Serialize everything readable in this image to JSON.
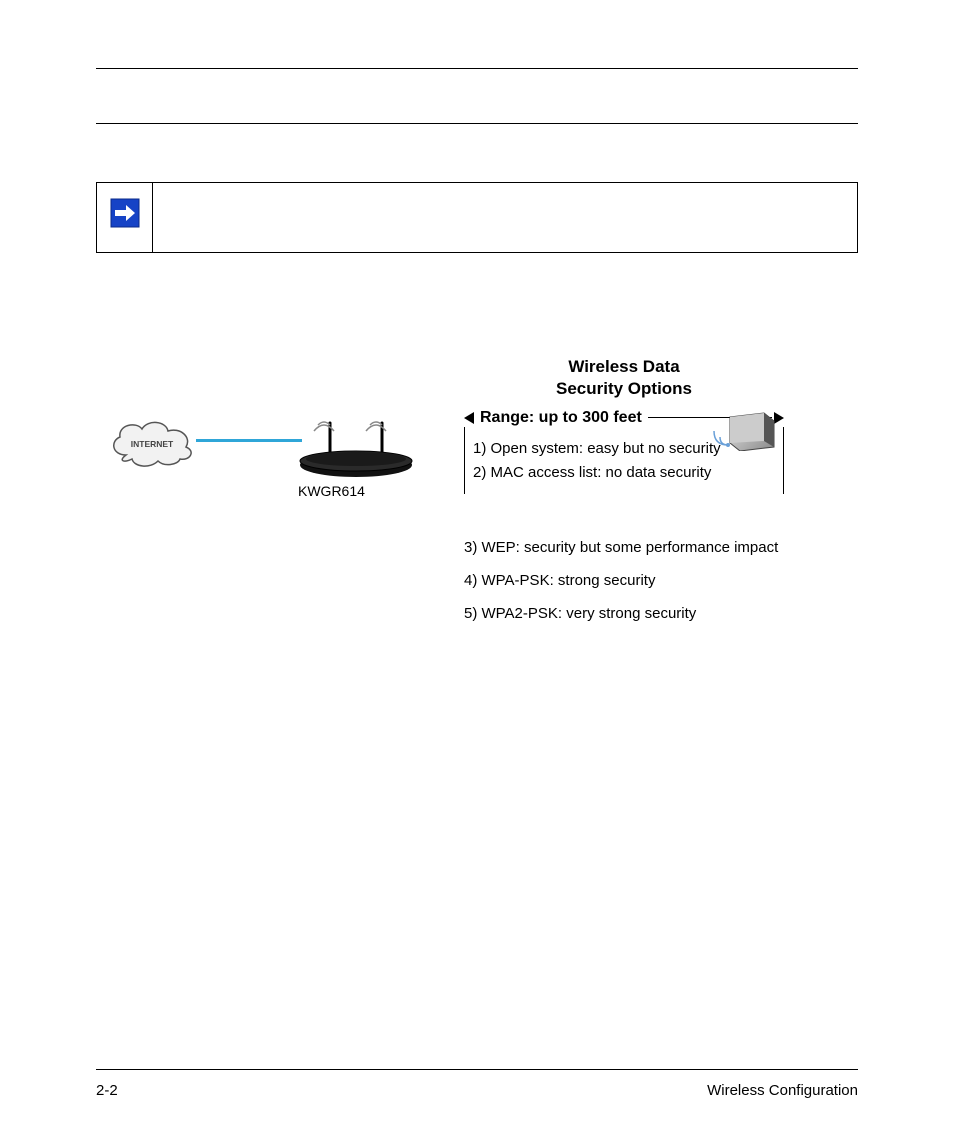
{
  "note": {
    "text": ""
  },
  "figure": {
    "router_label": "KWGR614",
    "title_line1": "Wireless Data",
    "title_line2": "Security Options",
    "range_label": "Range: up to 300 feet",
    "options": {
      "o1": "1) Open system: easy but no security",
      "o2": "2) MAC access list: no data security",
      "o3": "3) WEP: security but some performance impact",
      "o4": "4) WPA-PSK: strong security",
      "o5": "5) WPA2-PSK: very strong security"
    },
    "internet_label": "INTERNET"
  },
  "footer": {
    "page_number": "2-2",
    "section_title": "Wireless Configuration"
  }
}
